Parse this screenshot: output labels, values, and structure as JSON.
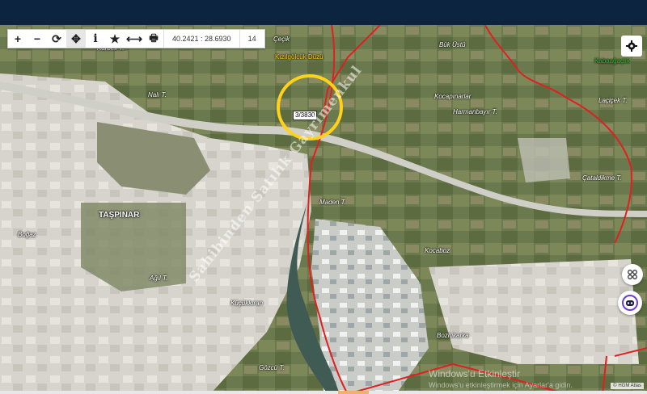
{
  "toolbar": {
    "coordinates": "40.2421 : 28.6930",
    "zoom": "14",
    "buttons": [
      {
        "name": "zoom-in",
        "glyph": "+"
      },
      {
        "name": "zoom-out",
        "glyph": "−"
      },
      {
        "name": "refresh",
        "glyph": "⟳"
      },
      {
        "name": "locate",
        "glyph": "✥"
      },
      {
        "name": "info",
        "glyph": "i"
      },
      {
        "name": "favorite",
        "glyph": "★"
      },
      {
        "name": "measure",
        "glyph": "⟷"
      },
      {
        "name": "print",
        "glyph": "🖶"
      }
    ]
  },
  "settings_icon": "gear-icon",
  "parcel_label": "3/3830",
  "place_labels": {
    "kizilgolcuk": "Kızılgölcük Düzü",
    "tasinar": "TAŞPINAR",
    "buk_ustu": "Bük Üstü",
    "kocapinar": "Kocapınarlar",
    "harmanbayir": "Harmanbayır T.",
    "lacicek": "Laçiçek T.",
    "caltidikme": "Çataldikme T.",
    "madan": "Maden T.",
    "kocaboz": "Kocaboz",
    "agil": "Ağıl T.",
    "bozlukarka": "Bozlukarka",
    "karbeli": "Karbeli T.",
    "nail": "Nalı T.",
    "bogaz": "Boğaz",
    "kucukkiran": "Küçükkıran",
    "cecik": "Çeçik",
    "gozcu": "Gözcü T.",
    "kabaagaclik": "Kabaağaçlık"
  },
  "watermark": "Sahibinden Satılık Gayrimenkul",
  "windows_line1": "Windows'u Etkinleştir",
  "windows_line2": "Windows'u etkinleştirmek için Ayarlar'a gidin.",
  "attribution": "© HGM Atlas"
}
